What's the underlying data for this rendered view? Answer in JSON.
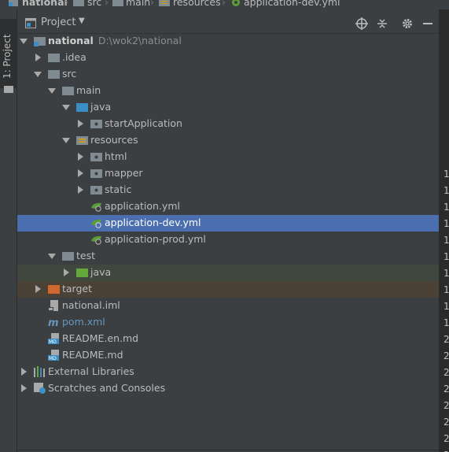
{
  "breadcrumb": {
    "items": [
      "national",
      "src",
      "main",
      "resources",
      "application-dev.yml"
    ]
  },
  "toolstrip": {
    "tab_label": "1: Project"
  },
  "panel": {
    "title": "Project",
    "caret": "▼",
    "buttons": [
      "crosshair-icon",
      "collapse-icon",
      "gear-icon",
      "minimize-icon"
    ]
  },
  "tree": [
    {
      "label": "national",
      "path": "D:\\wok2\\national"
    },
    {
      "label": ".idea"
    },
    {
      "label": "src"
    },
    {
      "label": "main"
    },
    {
      "label": "java"
    },
    {
      "label": "startApplication"
    },
    {
      "label": "resources"
    },
    {
      "label": "html"
    },
    {
      "label": "mapper"
    },
    {
      "label": "static"
    },
    {
      "label": "application.yml"
    },
    {
      "label": "application-dev.yml"
    },
    {
      "label": "application-prod.yml"
    },
    {
      "label": "test"
    },
    {
      "label": "java"
    },
    {
      "label": "target"
    },
    {
      "label": "national.iml"
    },
    {
      "label": "pom.xml"
    },
    {
      "label": "README.en.md"
    },
    {
      "label": "README.md"
    },
    {
      "label": "External Libraries"
    },
    {
      "label": "Scratches and Consoles"
    }
  ],
  "editor_line_numbers": [
    "1",
    "1",
    "1",
    "1",
    "1",
    "1",
    "1",
    "1",
    "1",
    "1",
    "2",
    "2",
    "2",
    "2",
    "2",
    "2",
    "2",
    "2"
  ],
  "colors": {
    "selection": "#4b6eaf",
    "test_highlight": "#3f473f",
    "excluded_highlight": "#4a4236",
    "folder": "#7f8b91",
    "source_folder": "#3b8fc4",
    "test_folder": "#62a83b",
    "excluded_folder": "#d0692f"
  }
}
